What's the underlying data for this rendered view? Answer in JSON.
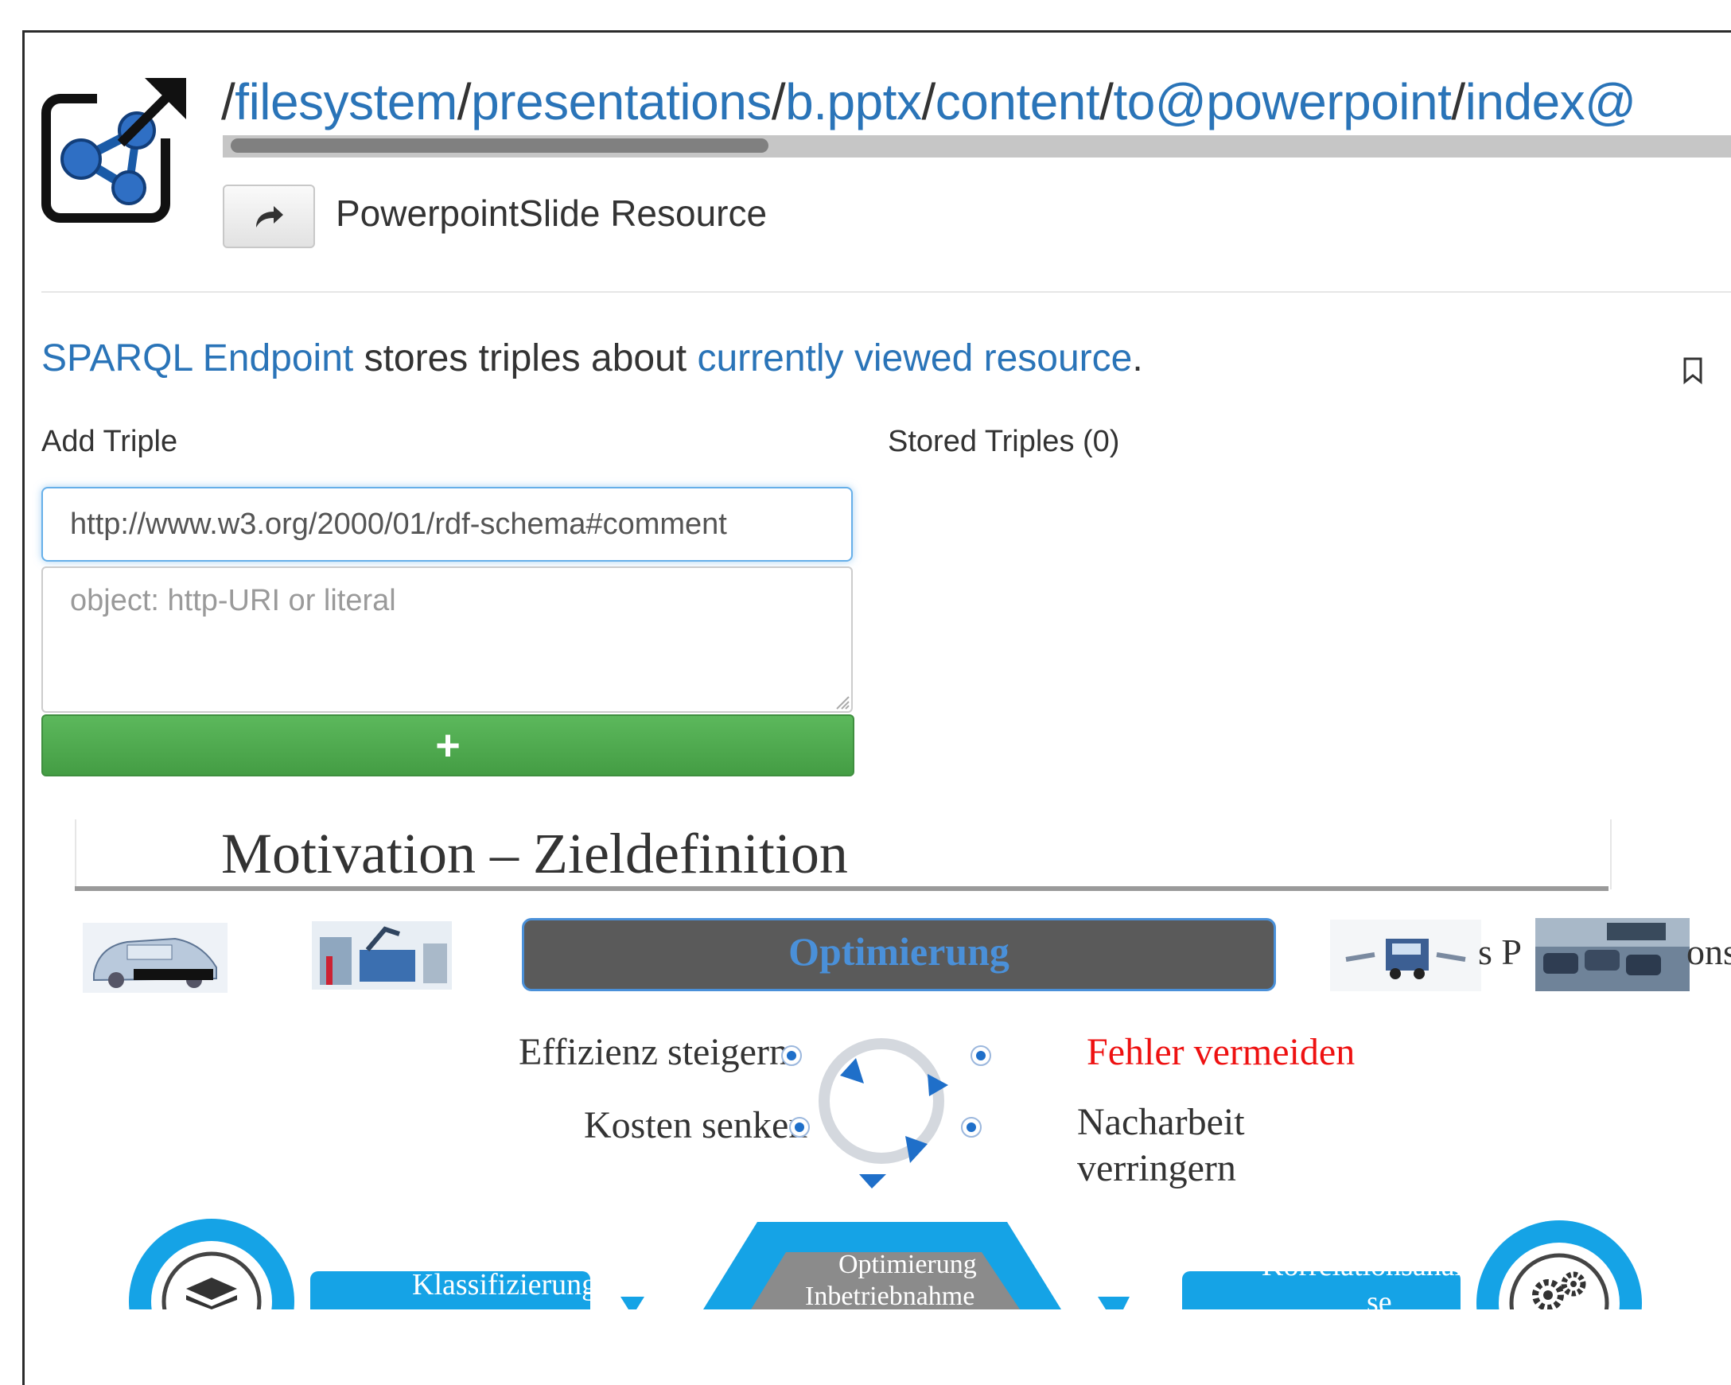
{
  "header": {
    "path_prefix": "/",
    "path_segments": [
      {
        "text": "filesystem",
        "sep": "/"
      },
      {
        "text": "presentations",
        "sep": "/"
      },
      {
        "text": "b.pptx",
        "sep": "/"
      },
      {
        "text": "content",
        "sep": "/"
      },
      {
        "text": "to@powerpoint",
        "sep": "/"
      },
      {
        "text": "index@",
        "sep": ""
      }
    ],
    "resource_type": "PowerpointSlide Resource",
    "logo_icon": "linked-data-share-icon",
    "share_icon": "share-arrow-icon"
  },
  "sparql": {
    "endpoint_link": "SPARQL Endpoint",
    "middle_text": " stores triples about ",
    "resource_link": "currently viewed resource",
    "end_text": ".",
    "bookmark_icon": "bookmark-icon"
  },
  "add_triple": {
    "label": "Add Triple",
    "predicate_value": "http://www.w3.org/2000/01/rdf-schema#comment",
    "object_placeholder": "object: http-URI or literal",
    "add_button_label": "+"
  },
  "stored_triples": {
    "label": "Stored Triples (0)"
  },
  "slide": {
    "title": "Motivation – Zieldefinition",
    "banner": "Optimierung",
    "partial_right_text": "s P",
    "partial_right_text2": "ons",
    "goals_left": [
      "Effizienz steigern",
      "Kosten senken"
    ],
    "goal_right_red": "Fehler vermeiden",
    "goal_right_2a": "Nacharbeit",
    "goal_right_2b": "verringern",
    "bottom_left_box": "Klassifizierung",
    "bottom_center_1": "Optimierung",
    "bottom_center_2": "Inbetriebnahme",
    "bottom_right_box_1": "Korrelationsanaly",
    "bottom_right_box_2": "se",
    "colors": {
      "accent": "#15a3e6",
      "banner_bg": "#5a5a5a",
      "banner_text": "#4a90d9",
      "red": "#ee1111"
    }
  }
}
